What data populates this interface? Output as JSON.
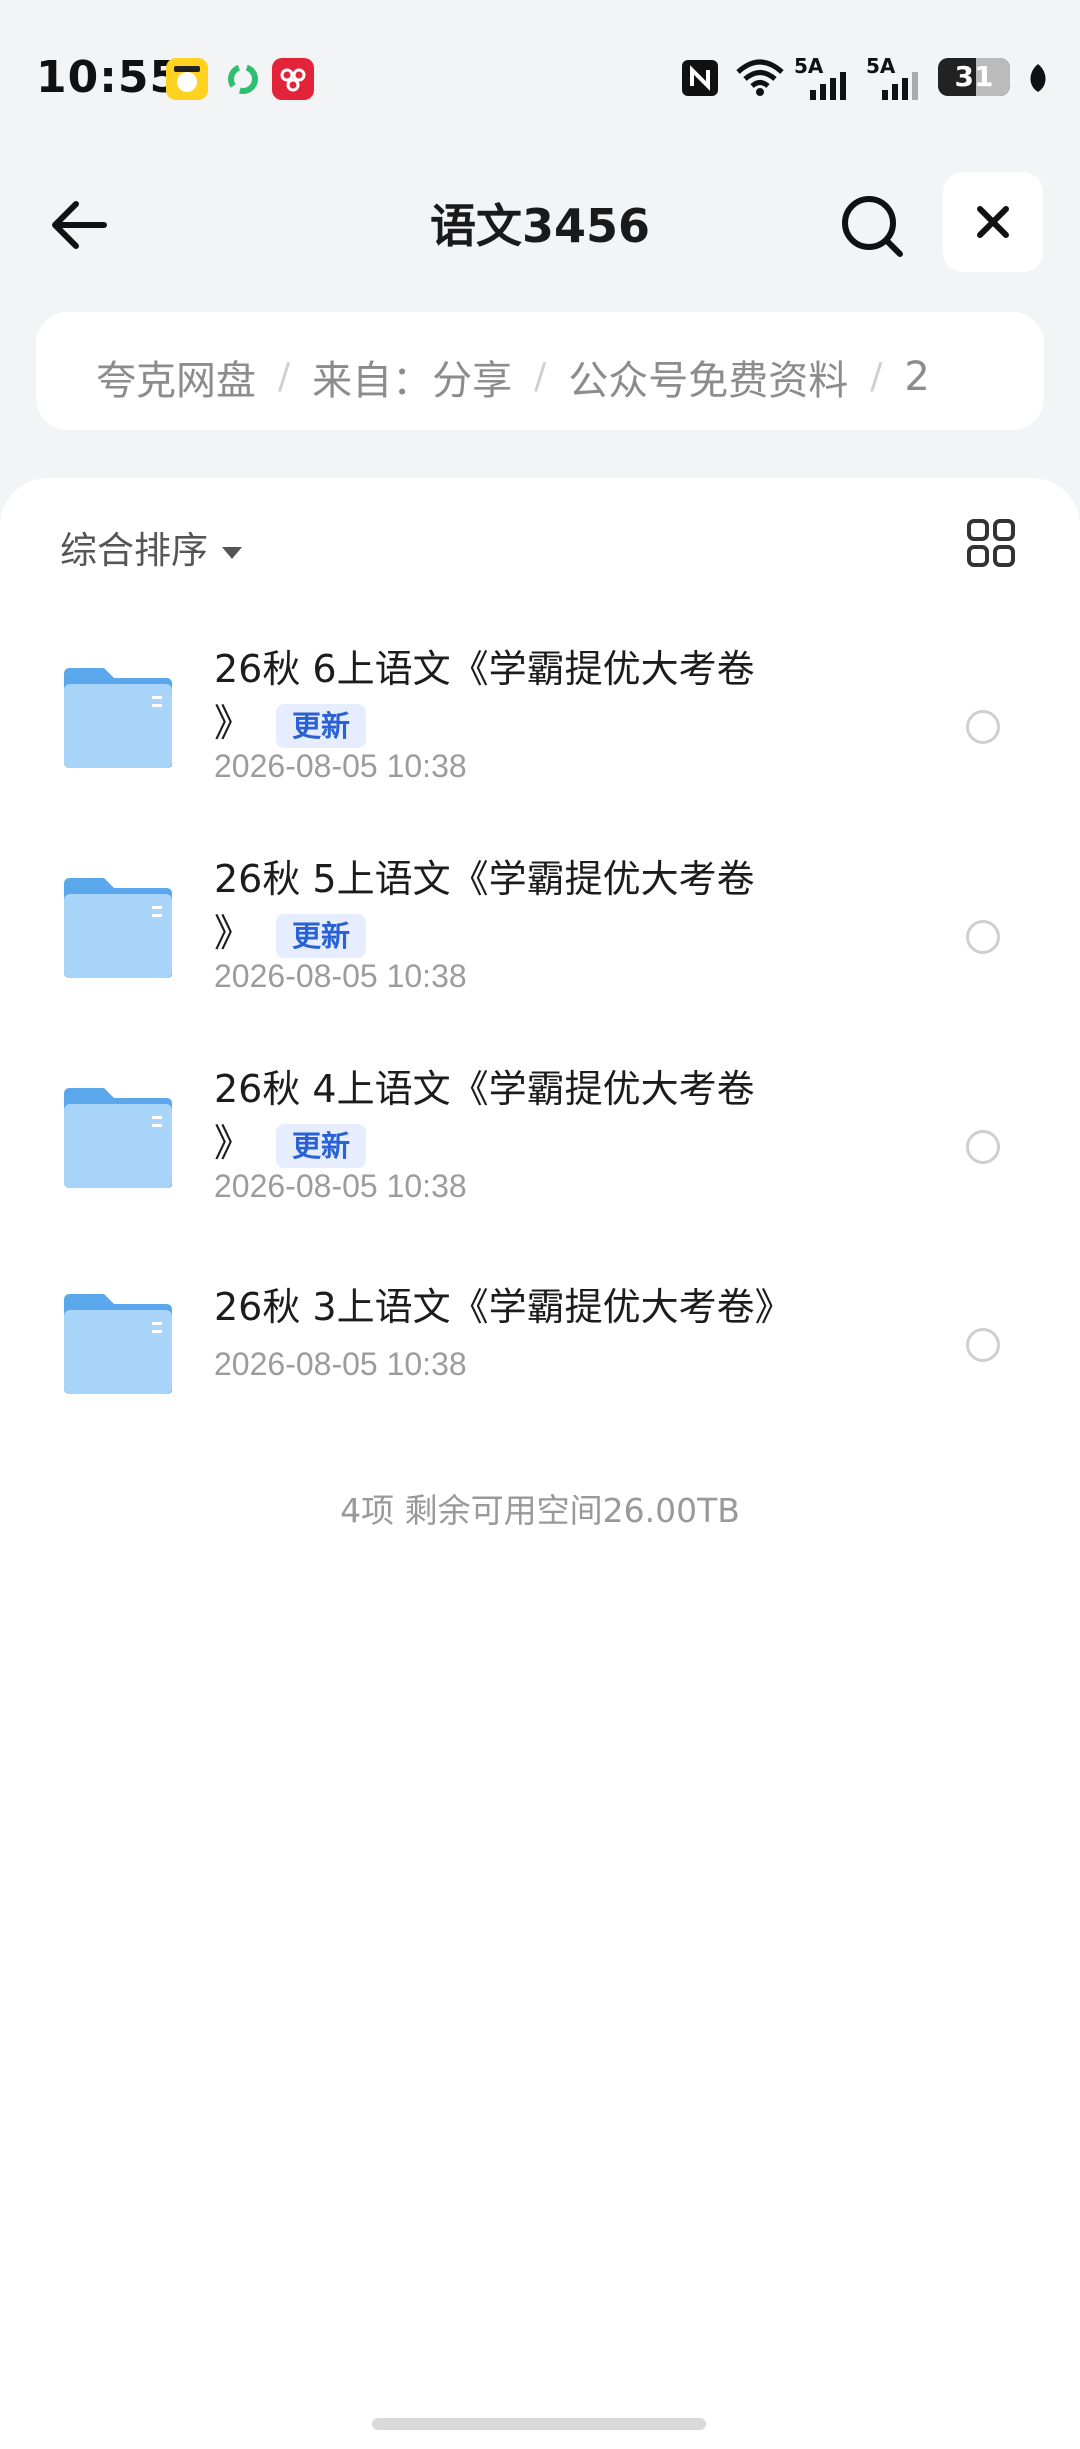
{
  "status_bar": {
    "time": "10:55",
    "network_1": "5A",
    "network_2": "5A",
    "battery": "31",
    "icons": [
      "app-badge-yellow",
      "app-badge-green-sync",
      "app-badge-red",
      "nfc-icon",
      "wifi-icon",
      "signal-icon",
      "battery-icon",
      "leaf-icon"
    ]
  },
  "header": {
    "title": "语文3456",
    "back_icon": "arrow-left-icon",
    "search_icon": "search-icon",
    "close_icon": "close-icon"
  },
  "breadcrumb": {
    "items": [
      "夸克网盘",
      "来自：分享",
      "公众号免费资料",
      "2"
    ],
    "separator": "/"
  },
  "toolbar": {
    "sort_label": "综合排序",
    "grid_icon": "grid-view-icon"
  },
  "files": [
    {
      "name_line1": "26秋 6上语文《学霸提优大考卷",
      "name_line2": "》",
      "tag": "更新",
      "date": "2026-08-05 10:38"
    },
    {
      "name_line1": "26秋 5上语文《学霸提优大考卷",
      "name_line2": "》",
      "tag": "更新",
      "date": "2026-08-05 10:38"
    },
    {
      "name_line1": "26秋 4上语文《学霸提优大考卷",
      "name_line2": "》",
      "tag": "更新",
      "date": "2026-08-05 10:38"
    },
    {
      "name_line1": "26秋 3上语文《学霸提优大考卷》",
      "date": "2026-08-05 10:38"
    }
  ],
  "summary": "4项 剩余可用空间26.00TB",
  "colors": {
    "accent": "#2a62d6",
    "tag_bg": "#e5edff",
    "folder": "#74b8f2"
  }
}
